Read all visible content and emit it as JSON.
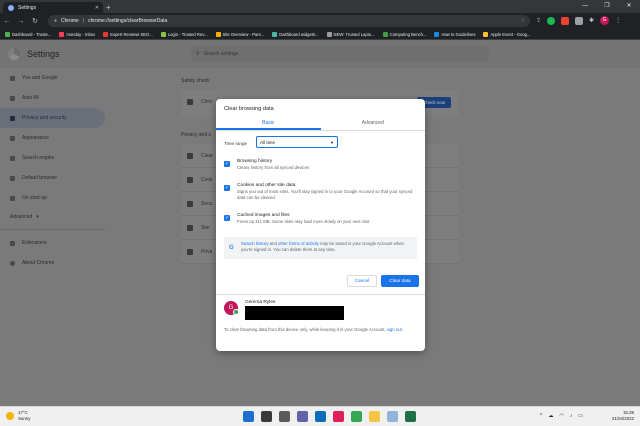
{
  "browser": {
    "tab_title": "Settings",
    "new_tab": "+",
    "url_host": "Chrome",
    "url_sep": "|",
    "url_path": "chrome://settings/clearBrowserData",
    "profile_initial": "G",
    "window_controls": [
      "—",
      "❐",
      "✕"
    ]
  },
  "bookmarks": [
    {
      "label": "Dashboard - Truste...",
      "color": "#4caf50"
    },
    {
      "label": "monday - Inbox",
      "color": "#ff3d57"
    },
    {
      "label": "Expert Reviews SEO...",
      "color": "#e53935"
    },
    {
      "label": "Login - Trusted Rev...",
      "color": "#8bc34a"
    },
    {
      "label": "Site Overview - Pars...",
      "color": "#ffb300"
    },
    {
      "label": "Dashboard widgets...",
      "color": "#4db6ac"
    },
    {
      "label": "NEW: Trusted Lapto...",
      "color": "#9e9e9e"
    },
    {
      "label": "Computing Bench...",
      "color": "#43a047"
    },
    {
      "label": "How to Guidelines",
      "color": "#1e88e5"
    },
    {
      "label": "Apple Event - Goog...",
      "color": "#fbc02d"
    }
  ],
  "settings": {
    "title": "Settings",
    "search_placeholder": "Search settings",
    "sidebar": [
      {
        "label": "You and Google"
      },
      {
        "label": "Auto-fill"
      },
      {
        "label": "Privacy and security"
      },
      {
        "label": "Appearance"
      },
      {
        "label": "Search engine"
      },
      {
        "label": "Default browser"
      },
      {
        "label": "On start-up"
      }
    ],
    "advanced_label": "Advanced",
    "extensions_label": "Extensions",
    "about_label": "About Chrome",
    "safety_check_header": "Safety check",
    "safety_row_text": "Chro",
    "check_now_button": "Check now",
    "privacy_header": "Privacy and s",
    "privacy_rows": [
      "Clear",
      "Cook",
      "Secu",
      "Site",
      "Priva"
    ]
  },
  "dialog": {
    "title": "Clear browsing data",
    "tabs": {
      "basic": "Basic",
      "advanced": "Advanced"
    },
    "time_range_label": "Time range",
    "time_range_value": "All time",
    "options": [
      {
        "title": "Browsing history",
        "desc": "Clears history from all synced devices"
      },
      {
        "title": "Cookies and other site data",
        "desc": "Signs you out of most sites. You'll stay signed in to your Google Account so that your synced data can be cleared."
      },
      {
        "title": "Cached images and files",
        "desc": "Frees up 311 MB. Some sites may load more slowly on your next visit."
      }
    ],
    "google_note": {
      "link1": "Search history",
      "and": " and ",
      "link2": "other forms of activity",
      "rest": " may be saved in your Google Account when you're signed in. You can delete them at any time."
    },
    "cancel_button": "Cancel",
    "clear_button": "Clear data",
    "account_initial": "G",
    "account_name": "Gemma Ryles",
    "footer_text": "To clear browsing data from this device only, while keeping it in your Google Account, ",
    "footer_link": "sign out",
    "footer_end": "."
  },
  "taskbar": {
    "temperature": "17°C",
    "weather": "Sunny",
    "time": "15:29",
    "date": "21/04/2022",
    "apps": [
      {
        "name": "windows-start",
        "color": "#1f6fd1"
      },
      {
        "name": "search",
        "color": "#3a3a3a"
      },
      {
        "name": "task-view",
        "color": "#5a5a5a"
      },
      {
        "name": "chat",
        "color": "#6264a7"
      },
      {
        "name": "outlook",
        "color": "#0f6cbd"
      },
      {
        "name": "slack",
        "color": "#e01e5a"
      },
      {
        "name": "chrome",
        "color": "#34a853"
      },
      {
        "name": "file-explorer",
        "color": "#f4c542"
      },
      {
        "name": "notepad",
        "color": "#8fb3d9"
      },
      {
        "name": "excel",
        "color": "#1d7044"
      }
    ]
  }
}
